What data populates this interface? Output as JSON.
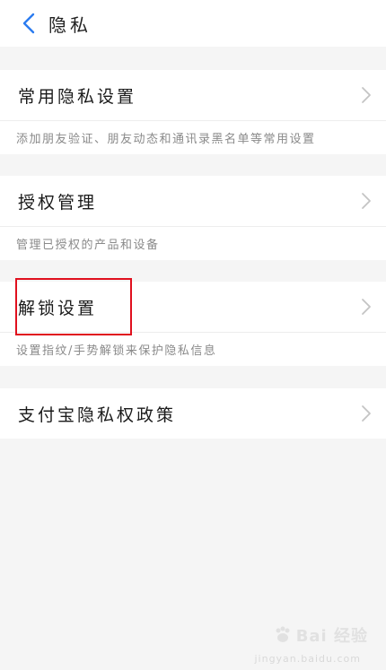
{
  "header": {
    "title": "隐私",
    "back_icon": "chevron-left-icon",
    "back_color": "#2b7cf0"
  },
  "sections": [
    {
      "label": "常用隐私设置",
      "description": "添加朋友验证、朋友动态和通讯录黑名单等常用设置"
    },
    {
      "label": "授权管理",
      "description": "管理已授权的产品和设备"
    },
    {
      "label": "解锁设置",
      "description": "设置指纹/手势解锁来保护隐私信息"
    },
    {
      "label": "支付宝隐私权政策"
    }
  ],
  "highlight_color": "#e0101e",
  "watermark": {
    "text": "Bai 经验",
    "sub": "jingyan.baidu.com"
  }
}
